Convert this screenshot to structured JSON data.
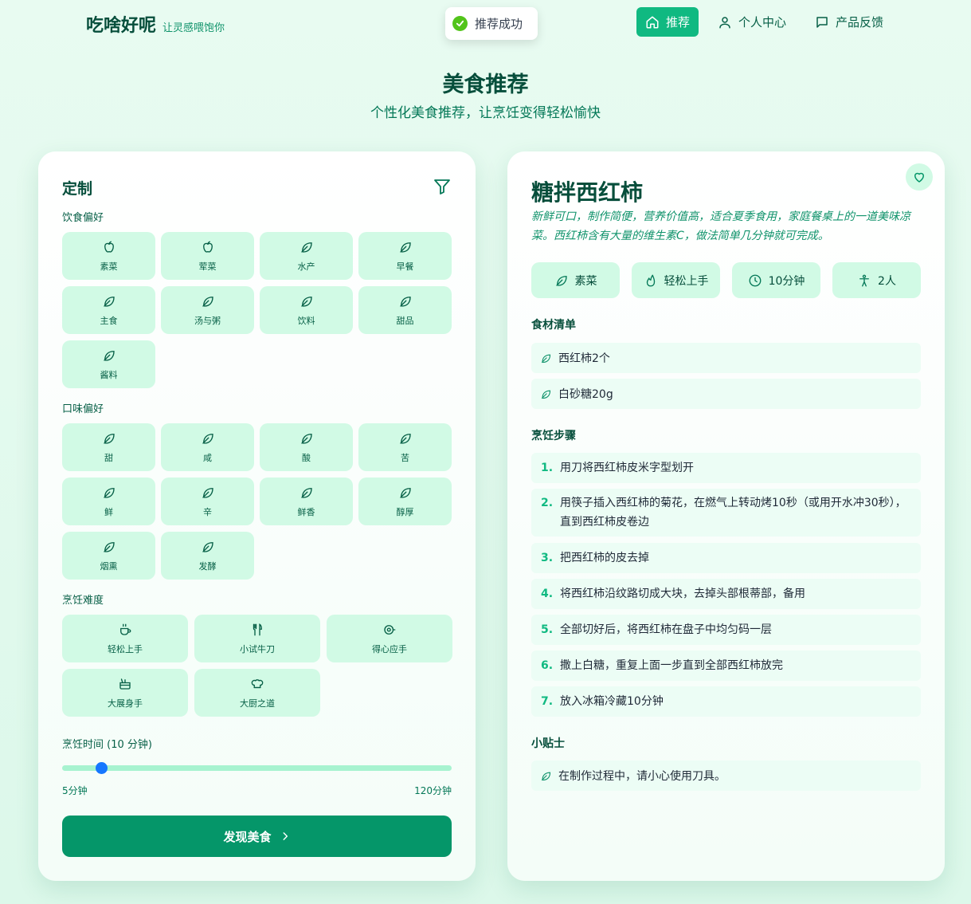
{
  "brand": {
    "name": "吃啥好呢",
    "slogan": "让灵感喂饱你"
  },
  "toast": {
    "text": "推荐成功"
  },
  "nav": {
    "items": [
      {
        "label": "推荐",
        "icon": "home-icon"
      },
      {
        "label": "个人中心",
        "icon": "user-icon"
      },
      {
        "label": "产品反馈",
        "icon": "message-icon"
      }
    ]
  },
  "hero": {
    "title": "美食推荐",
    "subtitle": "个性化美食推荐，让烹饪变得轻松愉快"
  },
  "customize": {
    "title": "定制",
    "diet": {
      "label": "饮食偏好",
      "options": [
        "素菜",
        "荤菜",
        "水产",
        "早餐",
        "主食",
        "汤与粥",
        "饮料",
        "甜品",
        "酱料"
      ]
    },
    "taste": {
      "label": "口味偏好",
      "options": [
        "甜",
        "咸",
        "酸",
        "苦",
        "鲜",
        "辛",
        "鲜香",
        "醇厚",
        "烟熏",
        "发酵"
      ]
    },
    "difficulty": {
      "label": "烹饪难度",
      "options": [
        "轻松上手",
        "小试牛刀",
        "得心应手",
        "大展身手",
        "大厨之道"
      ]
    },
    "time": {
      "label": "烹饪时间 (10 分钟)",
      "min_label": "5分钟",
      "max_label": "120分钟",
      "min": 5,
      "max": 120,
      "value": 10
    },
    "submit_label": "发现美食"
  },
  "dish": {
    "name": "糖拌西红柿",
    "description": "新鲜可口，制作简便，营养价值高，适合夏季食用，家庭餐桌上的一道美味凉菜。西红柿含有大量的维生素C，做法简单几分钟就可完成。",
    "tags": [
      {
        "label": "素菜",
        "icon": "leaf-icon"
      },
      {
        "label": "轻松上手",
        "icon": "flame-icon"
      },
      {
        "label": "10分钟",
        "icon": "clock-icon"
      },
      {
        "label": "2人",
        "icon": "person-icon"
      }
    ],
    "ingredients_title": "食材清单",
    "ingredients": [
      "西红柿2个",
      "白砂糖20g"
    ],
    "steps_title": "烹饪步骤",
    "steps": [
      {
        "num": "1.",
        "text": "用刀将西红柿皮米字型划开"
      },
      {
        "num": "2.",
        "text": "用筷子插入西红柿的菊花，在燃气上转动烤10秒（或用开水冲30秒），直到西红柿皮卷边"
      },
      {
        "num": "3.",
        "text": "把西红柿的皮去掉"
      },
      {
        "num": "4.",
        "text": "将西红柿沿纹路切成大块，去掉头部根蒂部，备用"
      },
      {
        "num": "5.",
        "text": "全部切好后，将西红柿在盘子中均匀码一层"
      },
      {
        "num": "6.",
        "text": "撒上白糖，重复上面一步直到全部西红柿放完"
      },
      {
        "num": "7.",
        "text": "放入冰箱冷藏10分钟"
      }
    ],
    "tips_title": "小贴士",
    "tips": [
      "在制作过程中，请小心使用刀具。"
    ]
  },
  "colors": {
    "accent": "#10b981",
    "button": "#059669",
    "tile": "#d1fae5",
    "slider_thumb": "#1677ff"
  }
}
